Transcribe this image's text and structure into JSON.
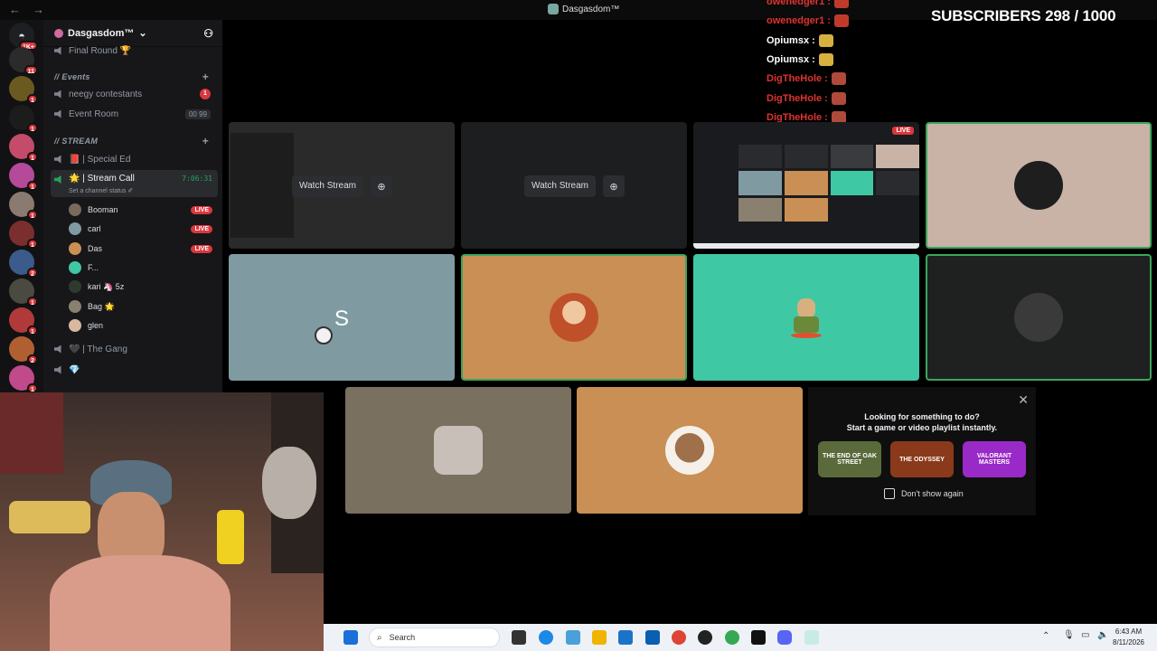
{
  "window": {
    "title": "Dasgasdom™",
    "nav_back": "←",
    "nav_forward": "→"
  },
  "rail": {
    "home_badge": "1K+",
    "servers": [
      {
        "badge": "11",
        "color": "#2b2b2b"
      },
      {
        "badge": "1",
        "color": "#6b5a20"
      },
      {
        "badge": "1",
        "color": "#1c1c1c"
      },
      {
        "badge": "1",
        "color": "#c44b6a"
      },
      {
        "badge": "1",
        "color": "#b54a9a"
      },
      {
        "badge": "1",
        "color": "#8a7a70"
      },
      {
        "badge": "1",
        "color": "#7a2e2e"
      },
      {
        "badge": "2",
        "color": "#3b5b8a"
      },
      {
        "badge": "1",
        "color": "#4a4a40"
      },
      {
        "badge": "1",
        "color": "#b03a3a"
      },
      {
        "badge": "2",
        "color": "#b06030"
      },
      {
        "badge": "1",
        "color": "#c04a8a"
      }
    ]
  },
  "server": {
    "name": "Dasgasdom™",
    "chevron": "⌄"
  },
  "channels": {
    "partial_top": "Final Round 🏆",
    "events_category": "// Events",
    "neegy": "neegy contestants",
    "neegy_badge": "1",
    "event_room": "Event Room",
    "event_room_counts": "00 99",
    "stream_category": "// STREAM",
    "special_ed": "📕 | Special Ed",
    "stream_call": "🌟 | Stream Call",
    "stream_call_timer": "7:06:31",
    "channel_status": "Set a channel status ✐",
    "the_gang": "🖤 | The Gang",
    "diamond": "💎"
  },
  "voice_users": [
    {
      "name": "Booman",
      "live": "LIVE",
      "color": "#7a6a5a"
    },
    {
      "name": "carl",
      "live": "LIVE",
      "color": "#7f9ba1"
    },
    {
      "name": "Das",
      "live": "LIVE",
      "color": "#c98f54"
    },
    {
      "name": "F...",
      "live": "",
      "color": "#3fc8a4"
    },
    {
      "name": "kari 🦄 5z",
      "live": "",
      "color": "#2f3a2f"
    },
    {
      "name": "Bag 🌟",
      "live": "",
      "color": "#8a8070"
    },
    {
      "name": "glen",
      "live": "",
      "color": "#d9b8a0"
    }
  ],
  "chat": [
    {
      "name": "owenedger1 :",
      "color": "#e0332f"
    },
    {
      "name": "owenedger1 :",
      "color": "#e0332f"
    },
    {
      "name": "Opiumsx :",
      "color": "#ffffff"
    },
    {
      "name": "Opiumsx :",
      "color": "#ffffff"
    },
    {
      "name": "DigTheHole :",
      "color": "#e0332f"
    },
    {
      "name": "DigTheHole :",
      "color": "#e0332f"
    },
    {
      "name": "DigTheHole :",
      "color": "#e0332f"
    }
  ],
  "subscribers": "SUBSCRIBERS 298 / 1000",
  "tiles": {
    "watch_stream": "Watch Stream",
    "live": "LIVE",
    "carl_initial": "S"
  },
  "activity": {
    "line1": "Looking for something to do?",
    "line2": "Start a game or video playlist instantly.",
    "dont_show": "Don't show again",
    "close": "✕",
    "games": [
      {
        "label": "THE END OF OAK STREET",
        "color": "#5a6a3a"
      },
      {
        "label": "THE ODYSSEY",
        "color": "#8a3a1a"
      },
      {
        "label": "VALORANT MASTERS",
        "color": "#9a2ac8"
      }
    ]
  },
  "taskbar": {
    "search": "Search",
    "time": "6:43 AM",
    "date": "8/11/2026"
  }
}
